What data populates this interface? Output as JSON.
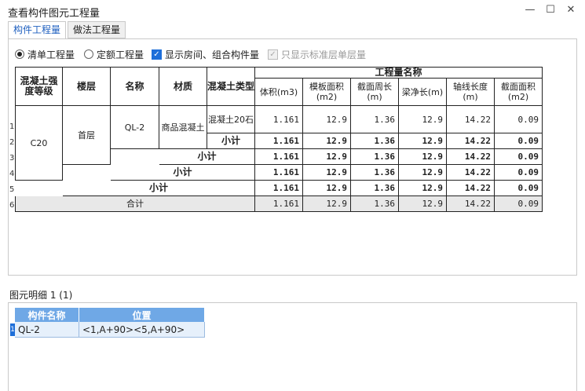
{
  "window": {
    "title": "查看构件图元工程量",
    "minimize": "—",
    "maximize": "☐",
    "close": "✕"
  },
  "tabs": [
    {
      "label": "构件工程量",
      "active": true
    },
    {
      "label": "做法工程量",
      "active": false
    }
  ],
  "options": {
    "radio_list": "清单工程量",
    "radio_quota": "定额工程量",
    "check_rooms": "显示房间、组合构件量",
    "check_std_floor": "只显示标准层单层量"
  },
  "table": {
    "headers": {
      "grade": "混凝土强度等级",
      "floor": "楼层",
      "name": "名称",
      "material": "材质",
      "concrete_type": "混凝土类型",
      "quantity_group": "工程量名称",
      "volume": "体积(m3)",
      "formwork": "模板面积(m2)",
      "perimeter": "截面周长(m)",
      "beam_len": "梁净长(m)",
      "axis_len": "轴线长度(m)",
      "section_area": "截面面积(m2)"
    },
    "row_numbers": [
      "1",
      "2",
      "3",
      "4",
      "5",
      "6"
    ],
    "grade_value": "C20",
    "floor_value": "首层",
    "name_value": "QL-2",
    "material_value": "商品混凝土",
    "concrete_type_value": "混凝土20石",
    "subtotal": "小计",
    "total": "合计",
    "rows": [
      [
        "1.161",
        "12.9",
        "1.36",
        "12.9",
        "14.22",
        "0.09"
      ],
      [
        "1.161",
        "12.9",
        "1.36",
        "12.9",
        "14.22",
        "0.09"
      ],
      [
        "1.161",
        "12.9",
        "1.36",
        "12.9",
        "14.22",
        "0.09"
      ],
      [
        "1.161",
        "12.9",
        "1.36",
        "12.9",
        "14.22",
        "0.09"
      ],
      [
        "1.161",
        "12.9",
        "1.36",
        "12.9",
        "14.22",
        "0.09"
      ],
      [
        "1.161",
        "12.9",
        "1.36",
        "12.9",
        "14.22",
        "0.09"
      ]
    ]
  },
  "detail": {
    "label": "图元明细  1 (1)",
    "headers": {
      "component": "构件名称",
      "position": "位置"
    },
    "row_index": "1",
    "row": {
      "component": "QL-2",
      "position": "<1,A+90><5,A+90>"
    }
  },
  "colors": {
    "accent": "#1e6fd9",
    "detail_header": "#6fa8e6"
  }
}
